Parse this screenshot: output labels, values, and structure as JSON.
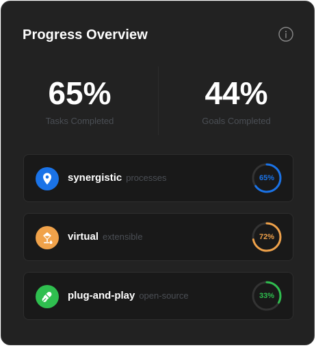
{
  "header": {
    "title": "Progress Overview",
    "info_icon": "info-circle-icon"
  },
  "stats": [
    {
      "value": "65%",
      "label": "Tasks Completed"
    },
    {
      "value": "44%",
      "label": "Goals Completed"
    }
  ],
  "items": [
    {
      "name": "synergistic",
      "subtitle": "processes",
      "percent_label": "65%",
      "percent": 65,
      "color": "#1a73e8",
      "icon": "location-pin-icon"
    },
    {
      "name": "virtual",
      "subtitle": "extensible",
      "percent_label": "72%",
      "percent": 72,
      "color": "#f0a24a",
      "icon": "drop-bucket-icon"
    },
    {
      "name": "plug-and-play",
      "subtitle": "open-source",
      "percent_label": "33%",
      "percent": 33,
      "color": "#2fbf4f",
      "icon": "capsule-pills-icon"
    }
  ],
  "colors": {
    "card_background": "#222222",
    "item_background": "#191919",
    "muted_text": "#4b4f55",
    "ring_track": "#333333"
  }
}
